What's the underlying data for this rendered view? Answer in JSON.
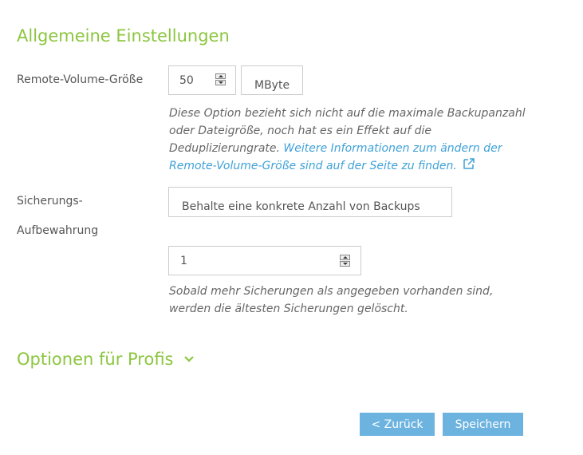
{
  "general": {
    "title": "Allgemeine Einstellungen"
  },
  "remote_volume": {
    "label": "Remote-Volume-Größe",
    "value": "50",
    "unit": "MByte",
    "help_text": "Diese Option bezieht sich nicht auf die maximale Backupanzahl oder Dateigröße, noch hat es ein Effekt auf die Deduplizierungrate.",
    "help_link": "Weitere Informationen zum ändern der Remote-Volume-Größe sind auf der Seite zu finden."
  },
  "retention": {
    "label_line1": "Sicherungs-",
    "label_line2": "Aufbewahrung",
    "select_value": "Behalte eine konkrete Anzahl von Backups",
    "count_value": "1",
    "help_text": "Sobald mehr Sicherungen als angegeben vorhanden sind, werden die ältesten Sicherungen gelöscht."
  },
  "advanced": {
    "title": "Optionen für Profis"
  },
  "buttons": {
    "back_label": "< Zurück",
    "save_label": "Speichern"
  },
  "colors": {
    "accent_green": "#8cc63f",
    "link_blue": "#3fa1d8",
    "button_blue": "#6cb3e0"
  },
  "icons": [
    "external-link-icon",
    "chevron-down-icon",
    "spinner-up-icon",
    "spinner-down-icon"
  ]
}
